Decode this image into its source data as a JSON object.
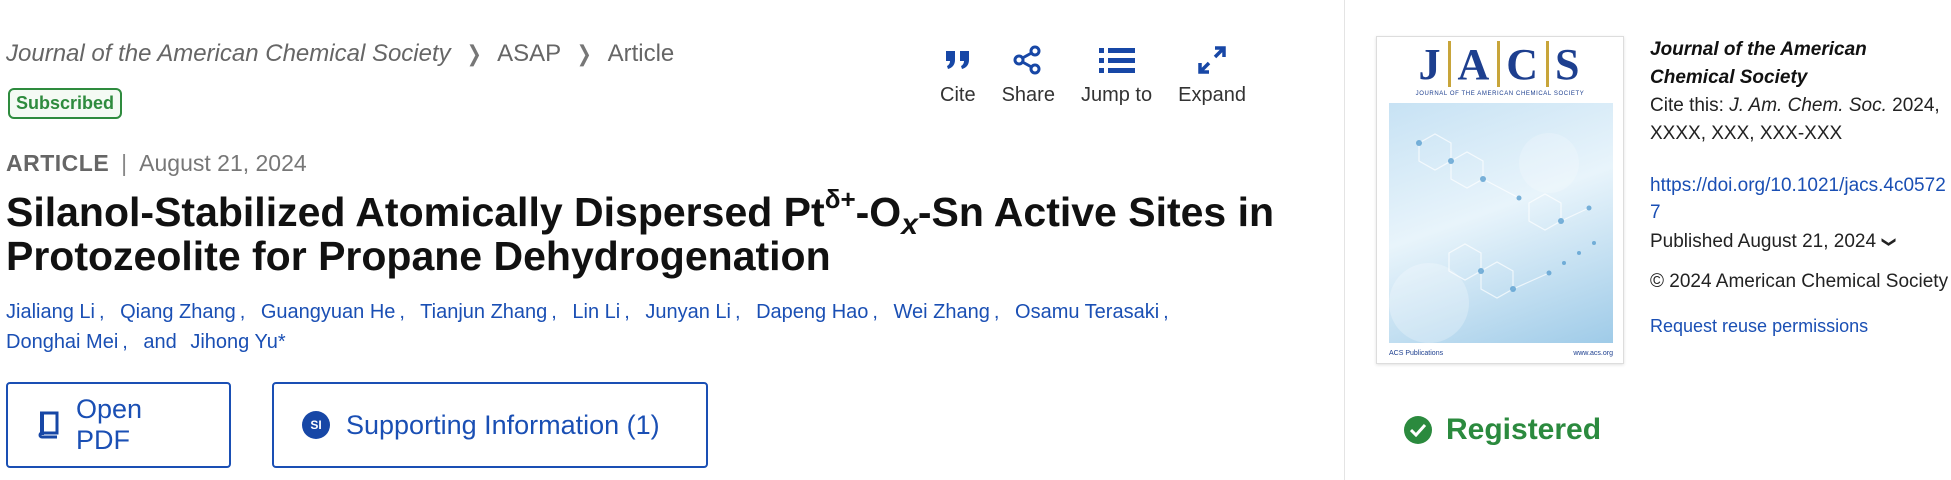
{
  "breadcrumb": {
    "journal": "Journal of the American Chemical Society",
    "section": "ASAP",
    "page": "Article"
  },
  "badge": "Subscribed",
  "toolbar": {
    "cite": "Cite",
    "share": "Share",
    "jump_to": "Jump to",
    "expand": "Expand"
  },
  "article": {
    "type": "ARTICLE",
    "date": "August 21, 2024",
    "title_parts": {
      "p1": "Silanol-Stabilized Atomically Dispersed Pt",
      "sup": "δ+",
      "p2": "-O",
      "sub": "x",
      "p3": "-Sn Active Sites in Protozeolite for Propane Dehydrogenation"
    }
  },
  "authors": [
    "Jialiang Li",
    "Qiang Zhang",
    "Guangyuan He",
    "Tianjun Zhang",
    "Lin Li",
    "Junyan Li",
    "Dapeng Hao",
    "Wei Zhang",
    "Osamu Terasaki",
    "Donghai Mei",
    "Jihong Yu*"
  ],
  "authors_and": "and",
  "buttons": {
    "pdf": "Open PDF",
    "si_badge": "SI",
    "si": "Supporting Information (1)"
  },
  "sidebar": {
    "cover": {
      "masthead": [
        "J",
        "A",
        "C",
        "S"
      ],
      "subtitle": "JOURNAL OF THE AMERICAN CHEMICAL SOCIETY",
      "publisher": "ACS Publications",
      "site": "www.acs.org"
    },
    "journal_name": "Journal of the American Chemical Society",
    "cite_label": "Cite this:",
    "cite_journal": "J. Am. Chem. Soc.",
    "cite_ref": "2024, XXXX, XXX, XXX-XXX",
    "doi": "https://doi.org/10.1021/jacs.4c05727",
    "published": "Published August 21, 2024",
    "copyright": "© 2024 American Chemical Society",
    "reuse": "Request reuse permissions",
    "registered": "Registered"
  },
  "colors": {
    "link": "#1a4fb4",
    "icon": "#1747a6",
    "success": "#2b8a3e"
  }
}
